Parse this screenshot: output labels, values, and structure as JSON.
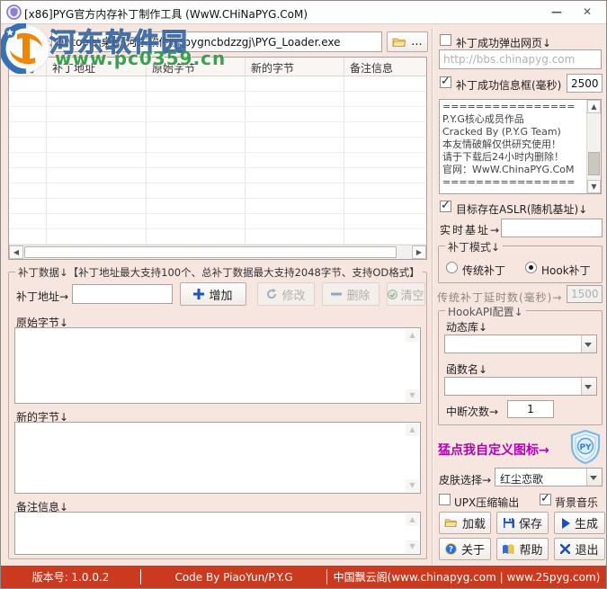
{
  "window": {
    "title": "[x86]PYG官方内存补丁制作工具 (WwW.CHiNaPYG.CoM)",
    "minimize_glyph": "—",
    "close_glyph": "✕"
  },
  "watermark": {
    "site_name": "河东软件园",
    "site_url": "www.pc0359.cn"
  },
  "target": {
    "label": "目标程序→",
    "path": "D:\\tools\\桌面\\河东软件园\\pygncbdzzgj\\PYG_Loader.exe",
    "browse_label": "..."
  },
  "table": {
    "columns": [
      "序号",
      "补丁地址",
      "原始字节",
      "新的字节",
      "备注信息"
    ],
    "empty_row_count": 11
  },
  "patch_group": {
    "title": "补丁数据↓【补丁地址最大支持100个、总补丁数据最大支持2048字节、支持OD格式】",
    "address_label": "补丁地址→",
    "add_label": "增加",
    "modify_label": "修改",
    "delete_label": "删除",
    "clear_label": "清空",
    "original_label": "原始字节↓",
    "new_label": "新的字节↓",
    "note_label": "备注信息↓"
  },
  "right": {
    "popup_web": {
      "label": "补丁成功弹出网页↓",
      "checked": false
    },
    "url_placeholder": "http://bbs.chinapyg.com",
    "msgbox": {
      "label": "补丁成功信息框(毫秒)",
      "checked": true,
      "value": "2500"
    },
    "message_text": "================\nP.Y.G核心成员作品\nCracked By  (P.Y.G Team)\n本友情破解仅供研究使用！\n请于下载后24小时内删除！\n官网：WwW.ChinaPYG.CoM\n================",
    "aslr": {
      "label": "目标存在ASLR(随机基址)↓",
      "checked": true
    },
    "base_label": "实时基址→",
    "base_value": "",
    "mode_group": {
      "title": "补丁模式↓",
      "traditional": {
        "label": "传统补丁",
        "selected": false
      },
      "hook": {
        "label": "Hook补丁",
        "selected": true
      }
    },
    "delay_label": "传统补丁延时数(毫秒)→",
    "delay_value": "1500",
    "hookapi": {
      "title": "HookAPI配置↓",
      "dll_label": "动态库↓",
      "dll_value": "",
      "func_label": "函数名↓",
      "func_value": "",
      "break_label": "中断次数→",
      "break_value": "1"
    },
    "icon_label": "猛点我自定义图标→",
    "skin_label": "皮肤选择→",
    "skin_value": "红尘恋歌",
    "upx": {
      "label": "UPX压缩输出",
      "checked": false
    },
    "music": {
      "label": "背景音乐",
      "checked": true
    },
    "buttons": {
      "load": "加载",
      "save": "保存",
      "generate": "生成",
      "about": "关于",
      "help": "帮助",
      "exit": "退出"
    }
  },
  "statusbar": {
    "version": "版本号: 1.0.0.2",
    "author": "Code By PiaoYun/P.Y.G",
    "site": "中国飘云阁(www.chinapyg.com | www.25pyg.com)"
  },
  "colors": {
    "accent_red": "#cb3a1e",
    "purple": "#b400b4",
    "blue_icon": "#1953c8",
    "green_wm": "#2f9e44"
  }
}
